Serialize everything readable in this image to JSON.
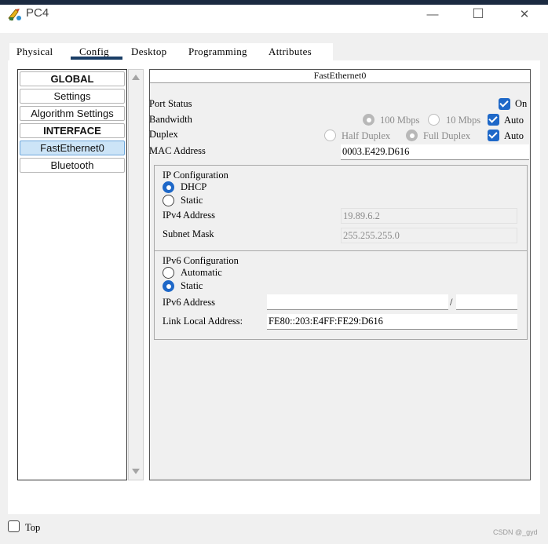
{
  "window": {
    "title": "PC4",
    "minimize_glyph": "—",
    "maximize_glyph": "☐",
    "close_glyph": "✕"
  },
  "tabs": [
    {
      "label": "Physical"
    },
    {
      "label": "Config",
      "selected": true
    },
    {
      "label": "Desktop"
    },
    {
      "label": "Programming"
    },
    {
      "label": "Attributes"
    }
  ],
  "sidebar": {
    "items": [
      {
        "label": "GLOBAL",
        "type": "header"
      },
      {
        "label": "Settings"
      },
      {
        "label": "Algorithm Settings"
      },
      {
        "label": "INTERFACE",
        "type": "header"
      },
      {
        "label": "FastEthernet0",
        "selected": true
      },
      {
        "label": "Bluetooth"
      }
    ]
  },
  "panel": {
    "title": "FastEthernet0",
    "port_status": {
      "label": "Port Status",
      "checkbox_label": "On",
      "checked": true
    },
    "bandwidth": {
      "label": "Bandwidth",
      "option1": "100 Mbps",
      "option2": "10 Mbps",
      "auto_label": "Auto",
      "auto": true
    },
    "duplex": {
      "label": "Duplex",
      "option1": "Half Duplex",
      "option2": "Full Duplex",
      "auto_label": "Auto",
      "auto": true
    },
    "mac": {
      "label": "MAC Address",
      "value": "0003.E429.D616"
    },
    "ipv4": {
      "title": "IP Configuration",
      "dhcp_label": "DHCP",
      "static_label": "Static",
      "selected": "DHCP",
      "address_label": "IPv4 Address",
      "address_value": "19.89.6.2",
      "mask_label": "Subnet Mask",
      "mask_value": "255.255.255.0"
    },
    "ipv6": {
      "title": "IPv6 Configuration",
      "auto_label": "Automatic",
      "static_label": "Static",
      "selected": "Static",
      "address_label": "IPv6 Address",
      "address_value": "",
      "prefix_separator": "/",
      "prefix_value": "",
      "link_local_label": "Link Local Address:",
      "link_local_value": "FE80::203:E4FF:FE29:D616"
    }
  },
  "footer": {
    "top_label": "Top",
    "top_checked": false
  },
  "watermark": "CSDN @_gyd",
  "colors": {
    "accent": "#1e68c8",
    "selected_item": "#cce4f7",
    "tab_underline": "#1a3e66",
    "titlebar_top": "#1b2a41"
  }
}
